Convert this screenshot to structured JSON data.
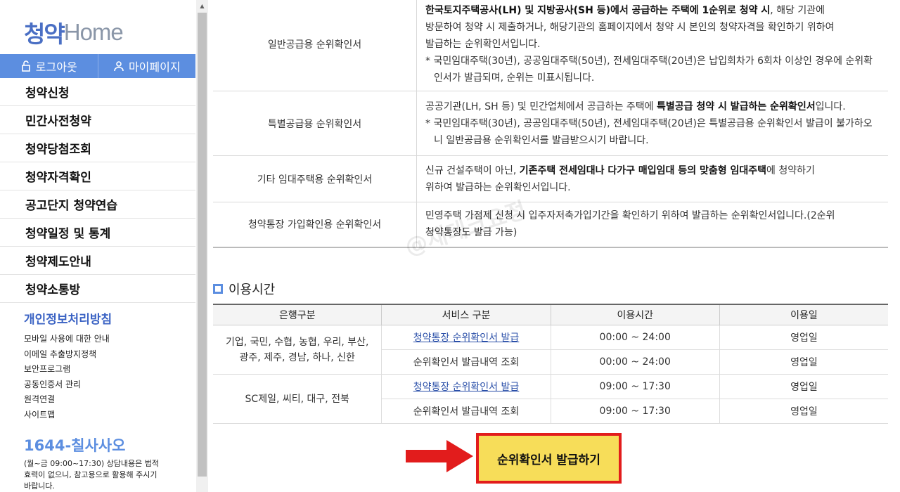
{
  "logo": {
    "ko": "청약",
    "en": "Home"
  },
  "topbar": {
    "logout": "로그아웃",
    "mypage": "마이페이지"
  },
  "menu": [
    "청약신청",
    "민간사전청약",
    "청약당첨조회",
    "청약자격확인",
    "공고단지 청약연습",
    "청약일정 및 통계",
    "청약제도안내",
    "청약소통방"
  ],
  "links": {
    "privacy": "개인정보처리방침",
    "items": [
      "모바일 사용에 대한 안내",
      "이메일 추출방지정책",
      "보안프로그램",
      "공동인증서 관리",
      "원격연결",
      "사이트맵"
    ]
  },
  "contact": {
    "phone": "1644-칠사사오",
    "note": "(월~금 09:00~17:30) 상담내용은 법적효력이 없으니, 참고용으로 활용해 주시기 바랍니다."
  },
  "cert_rows": [
    {
      "label": "일반공급용 순위확인서",
      "desc_html": "<b>한국토지주택공사(LH) 및 지방공사(SH 등)에서 공급하는 주택에 1순위로 청약 시</b>, 해당 기관에<br>방문하여 청약 시 제출하거나, 해당기관의 홈페이지에서 청약 시 본인의 청약자격을 확인하기 위하여<br>발급하는 순위확인서입니다.",
      "sub": "* 국민임대주택(30년), 공공임대주택(50년), 전세임대주택(20년)은 납입회차가 6회차 이상인 경우에 순위확인서가 발급되며, 순위는 미표시됩니다."
    },
    {
      "label": "특별공급용 순위확인서",
      "desc_html": "공공기관(LH, SH 등) 및 민간업체에서 공급하는 주택에 <b>특별공급 청약 시 발급하는 순위확인서</b>입니다.",
      "sub": "* 국민임대주택(30년), 공공임대주택(50년), 전세임대주택(20년)은 특별공급용 순위확인서 발급이 불가하오니 일반공급용 순위확인서를 발급받으시기 바랍니다."
    },
    {
      "label": "기타 임대주택용 순위확인서",
      "desc_html": "신규 건설주택이 아닌, <b>기존주택 전세임대나 다가구 매입임대 등의 맞춤형 임대주택</b>에 청약하기<br>위하여 발급하는 순위확인서입니다.",
      "sub": ""
    },
    {
      "label": "청약통장 가입확인용 순위확인서",
      "desc_html": "민영주택 가점제 신청 시 입주자저축가입기간을 확인하기 위하여 발급하는 순위확인서입니다.(2순위<br>청약통장도 발급 가능)",
      "sub": ""
    }
  ],
  "section_title": "이용시간",
  "time_table": {
    "headers": [
      "은행구분",
      "서비스 구분",
      "이용시간",
      "이용일"
    ],
    "groups": [
      {
        "bank": "기업, 국민, 수협, 농협, 우리, 부산, 광주, 제주, 경남, 하나, 신한",
        "rows": [
          {
            "service": "청약통장 순위확인서 발급",
            "time": "00:00 ~ 24:00",
            "day": "영업일",
            "link": true
          },
          {
            "service": "순위확인서 발급내역 조회",
            "time": "00:00 ~ 24:00",
            "day": "영업일",
            "link": false
          }
        ]
      },
      {
        "bank": "SC제일, 씨티, 대구, 전북",
        "rows": [
          {
            "service": "청약통장 순위확인서 발급",
            "time": "09:00 ~ 17:30",
            "day": "영업일",
            "link": true
          },
          {
            "service": "순위확인서 발급내역 조회",
            "time": "09:00 ~ 17:30",
            "day": "영업일",
            "link": false
          }
        ]
      }
    ]
  },
  "issue_button": "순위확인서 발급하기",
  "watermark": "@재테크요정",
  "colors": {
    "accent": "#5c8ee0",
    "button_bg": "#f7dd59",
    "highlight": "#e21c1c"
  }
}
